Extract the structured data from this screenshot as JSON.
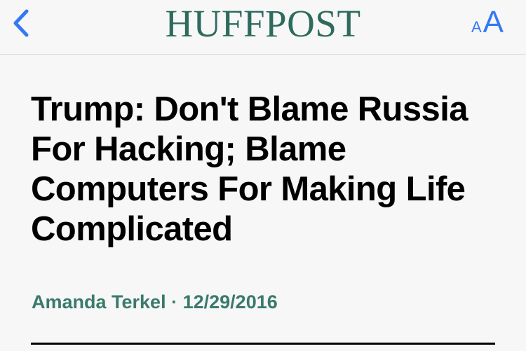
{
  "header": {
    "logo_text": "HUFFPOST",
    "back_icon": "chevron-left-icon",
    "text_size_small": "A",
    "text_size_large": "A",
    "accent_color": "#3478f6",
    "logo_color": "#2e6b5d"
  },
  "article": {
    "headline": "Trump: Don't Blame Russia For Hacking; Blame Computers For Making Life Complicated",
    "author": "Amanda Terkel",
    "separator": "·",
    "date": "12/29/2016"
  }
}
